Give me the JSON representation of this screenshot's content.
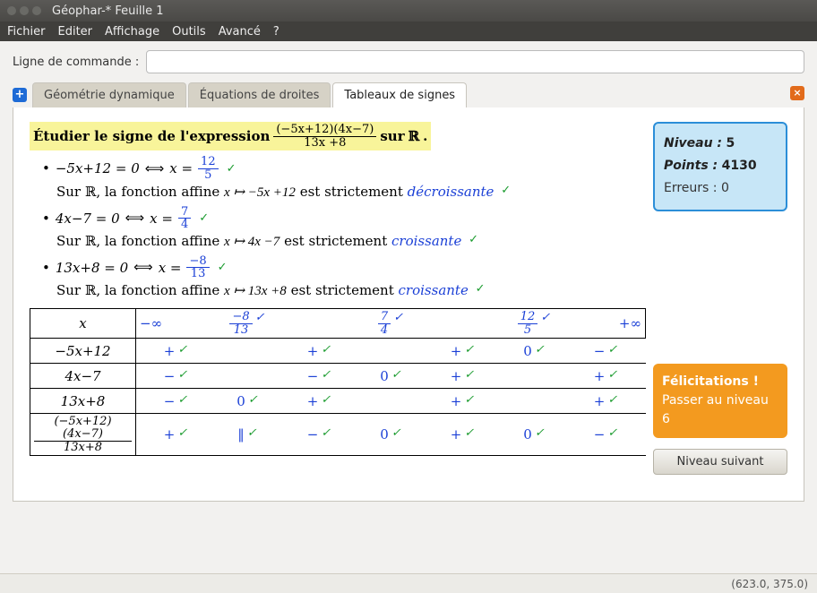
{
  "window": {
    "title": "Géophar-* Feuille 1"
  },
  "menu": {
    "items": [
      "Fichier",
      "Editer",
      "Affichage",
      "Outils",
      "Avancé",
      "?"
    ]
  },
  "cmdline": {
    "label": "Ligne de commande :",
    "value": ""
  },
  "tabs": {
    "items": [
      {
        "label": "Géométrie dynamique",
        "active": false
      },
      {
        "label": "Équations de droites",
        "active": false
      },
      {
        "label": "Tableaux de signes",
        "active": true
      }
    ],
    "add_icon": "+",
    "close_icon": "×"
  },
  "exercise": {
    "prompt_prefix": "Étudier le signe de l'expression",
    "prompt_suffix": "sur",
    "domain_symbol": "ℝ",
    "expression": {
      "num": "(−5x+12)(4x−7)",
      "den": "13x +8"
    },
    "factors": [
      {
        "eq": "−5x+12 = 0",
        "root": {
          "num": "12",
          "den": "5"
        },
        "func": "x ↦ −5x +12",
        "monotone": "décroissante"
      },
      {
        "eq": "4x−7 = 0",
        "root": {
          "num": "7",
          "den": "4"
        },
        "func": "x ↦ 4x −7",
        "monotone": "croissante"
      },
      {
        "eq": "13x+8 = 0",
        "root": {
          "num": "−8",
          "den": "13"
        },
        "func": "x ↦ 13x +8",
        "monotone": "croissante"
      }
    ],
    "strict_text": "est strictement",
    "sur_text": "Sur ℝ, la fonction affine",
    "iff": "⟺",
    "x_eq": "x ="
  },
  "table": {
    "var": "x",
    "neg_inf": "−∞",
    "pos_inf": "+∞",
    "breakpoints": [
      {
        "num": "−8",
        "den": "13"
      },
      {
        "num": "7",
        "den": "4"
      },
      {
        "num": "12",
        "den": "5"
      }
    ],
    "rows": [
      {
        "label": "−5x+12",
        "cells": [
          "+",
          "",
          "+",
          "",
          "+",
          "0",
          "−"
        ]
      },
      {
        "label": "4x−7",
        "cells": [
          "−",
          "",
          "−",
          "0",
          "+",
          "",
          "+"
        ]
      },
      {
        "label": "13x+8",
        "cells": [
          "−",
          "0",
          "+",
          "",
          "+",
          "",
          "+"
        ]
      },
      {
        "label_frac": {
          "num": "(−5x+12)(4x−7)",
          "den": "13x+8"
        },
        "cells": [
          "+",
          "‖",
          "−",
          "0",
          "+",
          "0",
          "−"
        ]
      }
    ]
  },
  "sidebar": {
    "level_label": "Niveau :",
    "level": "5",
    "points_label": "Points :",
    "points": "4130",
    "errors_label": "Erreurs :",
    "errors": "0",
    "congrats_title": "Félicitations !",
    "congrats_sub": "Passer au niveau 6",
    "next_button": "Niveau suivant"
  },
  "status": {
    "coords": "(623.0, 375.0)"
  }
}
